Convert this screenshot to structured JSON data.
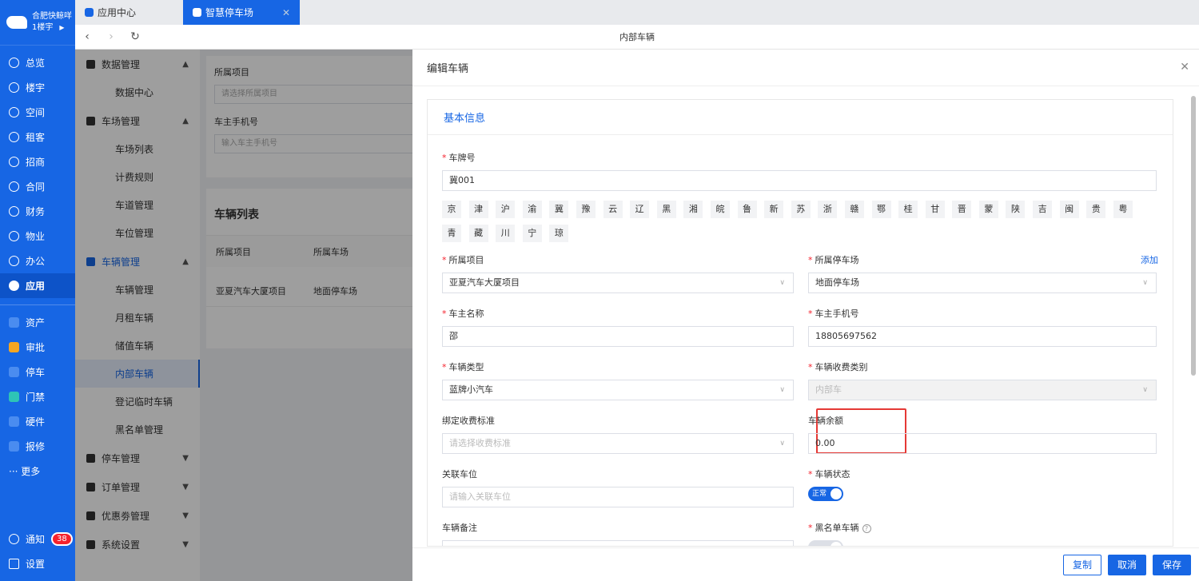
{
  "brand": {
    "name": "合肥快鲸咩",
    "building": "1楼宇"
  },
  "rail": {
    "items": [
      {
        "label": "总览",
        "icon": "dashboard-icon"
      },
      {
        "label": "楼宇",
        "icon": "building-icon"
      },
      {
        "label": "空间",
        "icon": "cube-icon"
      },
      {
        "label": "租客",
        "icon": "users-icon"
      },
      {
        "label": "招商",
        "icon": "tag-icon"
      },
      {
        "label": "合同",
        "icon": "document-icon"
      },
      {
        "label": "财务",
        "icon": "money-icon"
      },
      {
        "label": "物业",
        "icon": "home-icon"
      },
      {
        "label": "办公",
        "icon": "monitor-icon"
      },
      {
        "label": "应用",
        "icon": "app-icon"
      }
    ],
    "apps": [
      {
        "label": "资产",
        "icon": "asset-icon",
        "color": "#4a8cf0"
      },
      {
        "label": "审批",
        "icon": "approve-icon",
        "color": "#f5a623"
      },
      {
        "label": "停车",
        "icon": "parking-icon",
        "color": "#4a8cf0"
      },
      {
        "label": "门禁",
        "icon": "door-icon",
        "color": "#2ec4b6"
      },
      {
        "label": "硬件",
        "icon": "hardware-icon",
        "color": "#4a8cf0"
      },
      {
        "label": "报修",
        "icon": "repair-icon",
        "color": "#4a8cf0"
      }
    ],
    "more": "··· 更多",
    "notify": "通知",
    "notify_count": "38",
    "settings": "设置"
  },
  "tabs": [
    {
      "label": "应用中心"
    },
    {
      "label": "智慧停车场"
    }
  ],
  "address_title": "内部车辆",
  "submenu": {
    "g1": "数据管理",
    "g1_items": [
      "数据中心"
    ],
    "g2": "车场管理",
    "g2_items": [
      "车场列表",
      "计费规则",
      "车道管理",
      "车位管理"
    ],
    "g3": "车辆管理",
    "g3_items": [
      "车辆管理",
      "月租车辆",
      "储值车辆",
      "内部车辆",
      "登记临时车辆",
      "黑名单管理"
    ],
    "g4": "停车管理",
    "g5": "订单管理",
    "g6": "优惠劵管理",
    "g7": "系统设置"
  },
  "page": {
    "f1_label": "所属项目",
    "f1_ph": "请选择所属项目",
    "f2_label": "车主手机号",
    "f2_ph": "输入车主手机号",
    "list_title": "车辆列表",
    "th": [
      "所属项目",
      "所属车场"
    ],
    "row": [
      "亚夏汽车大厦项目",
      "地面停车场"
    ]
  },
  "drawer": {
    "title": "编辑车辆",
    "section": "基本信息",
    "plate_label": "车牌号",
    "plate_value": "冀001",
    "provinces": [
      "京",
      "津",
      "沪",
      "渝",
      "冀",
      "豫",
      "云",
      "辽",
      "黑",
      "湘",
      "皖",
      "鲁",
      "新",
      "苏",
      "浙",
      "赣",
      "鄂",
      "桂",
      "甘",
      "晋",
      "蒙",
      "陕",
      "吉",
      "闽",
      "贵",
      "粤",
      "青",
      "藏",
      "川",
      "宁",
      "琼"
    ],
    "project_label": "所属项目",
    "project_value": "亚夏汽车大厦项目",
    "lot_label": "所属停车场",
    "lot_value": "地面停车场",
    "add_link": "添加",
    "owner_label": "车主名称",
    "owner_value": "邵",
    "phone_label": "车主手机号",
    "phone_value": "18805697562",
    "type_label": "车辆类型",
    "type_value": "蓝牌小汽车",
    "fee_cat_label": "车辆收费类别",
    "fee_cat_value": "内部车",
    "std_label": "绑定收费标准",
    "std_ph": "请选择收费标准",
    "balance_label": "车辆余额",
    "balance_value": "0.00",
    "space_label": "关联车位",
    "space_ph": "请输入关联车位",
    "status_label": "车辆状态",
    "status_value": "正常",
    "remark_label": "车辆备注",
    "blacklist_label": "黑名单车辆",
    "buttons": {
      "copy": "复制",
      "cancel": "取消",
      "save": "保存"
    }
  }
}
